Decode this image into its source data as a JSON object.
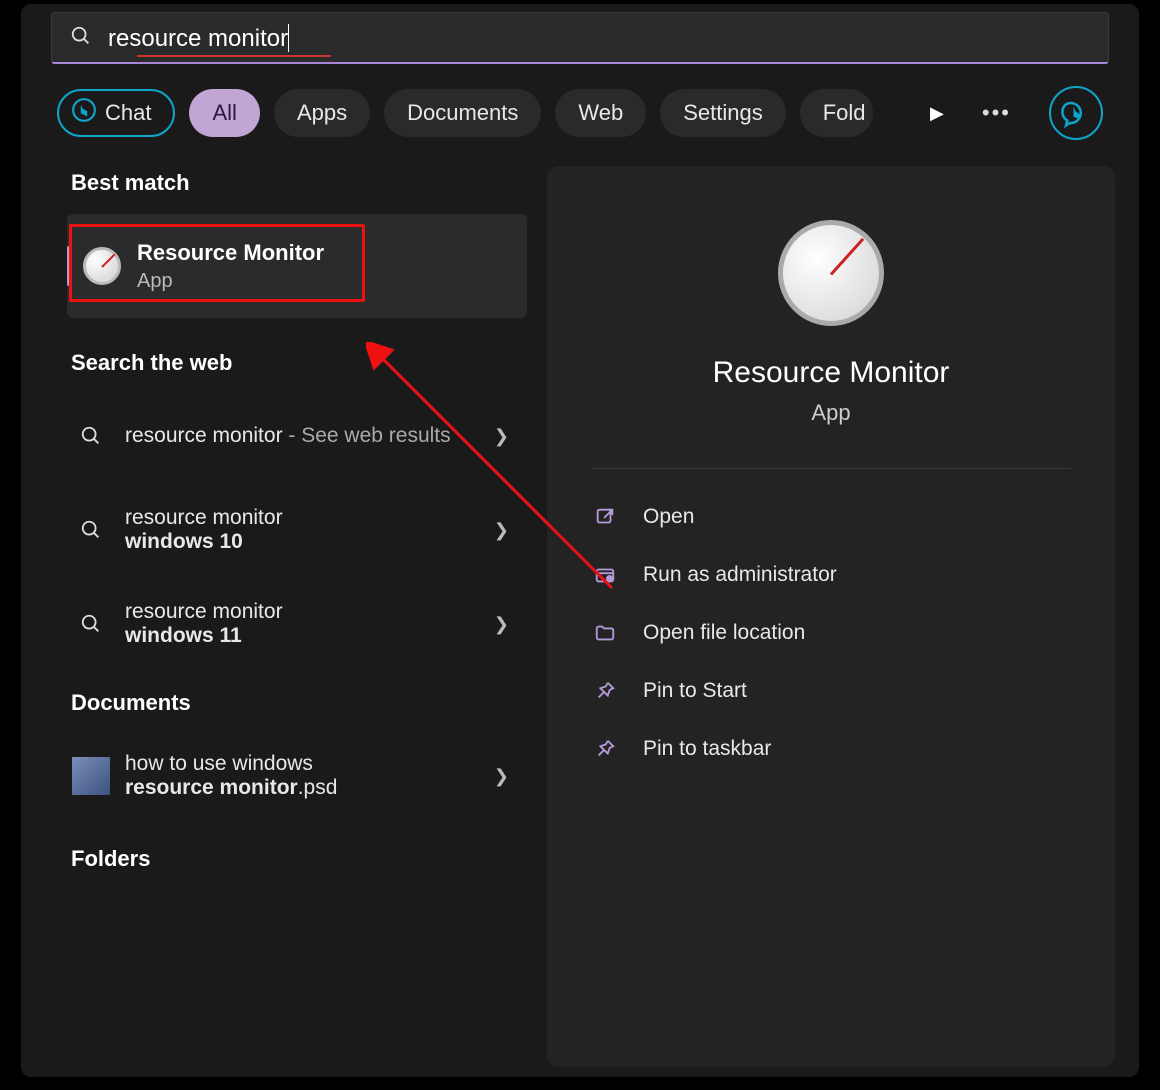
{
  "search": {
    "query": "resource monitor"
  },
  "tabs": {
    "chat": "Chat",
    "all": "All",
    "apps": "Apps",
    "documents": "Documents",
    "web": "Web",
    "settings": "Settings",
    "folders": "Fold",
    "more_glyph": "▶",
    "overflow_glyph": "•••"
  },
  "left": {
    "best_match_heading": "Best match",
    "best_match": {
      "title": "Resource Monitor",
      "subtitle": "App"
    },
    "search_web_heading": "Search the web",
    "web_items": [
      {
        "prefix": "resource monitor",
        "suffix": " - See web results",
        "line2": ""
      },
      {
        "prefix": "resource monitor",
        "suffix": "",
        "line2": "windows 10"
      },
      {
        "prefix": "resource monitor",
        "suffix": "",
        "line2": "windows 11"
      }
    ],
    "documents_heading": "Documents",
    "doc_item": {
      "line1": "how to use windows",
      "line2_bold": "resource monitor",
      "line2_ext": ".psd"
    },
    "folders_heading": "Folders"
  },
  "right": {
    "title": "Resource Monitor",
    "subtitle": "App",
    "actions": {
      "open": "Open",
      "admin": "Run as administrator",
      "file_location": "Open file location",
      "pin_start": "Pin to Start",
      "pin_taskbar": "Pin to taskbar"
    }
  }
}
